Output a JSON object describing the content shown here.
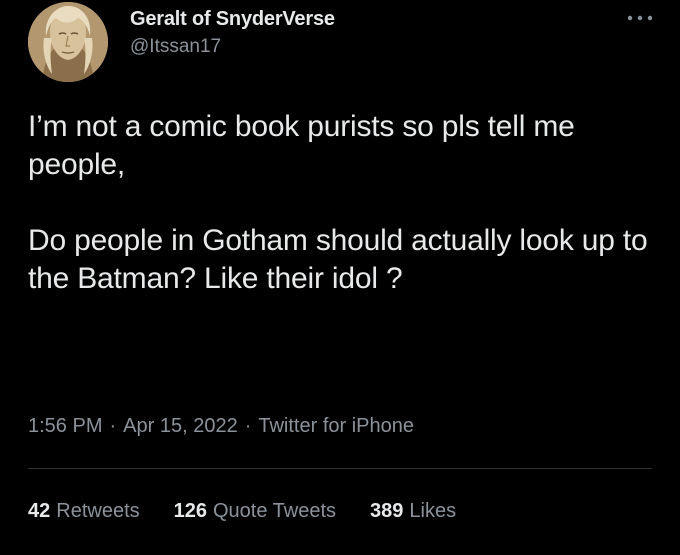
{
  "author": {
    "display_name": "Geralt of SnyderVerse",
    "handle": "@Itssan17",
    "avatar_icon": "user-avatar"
  },
  "tweet": {
    "text_paragraphs": [
      "I’m not a comic book purists so pls tell me people,",
      "Do people in Gotham should actually look up to the Batman? Like their idol ?"
    ]
  },
  "meta": {
    "time": "1:56 PM",
    "separator": "·",
    "date": "Apr 15, 2022",
    "source": "Twitter for iPhone"
  },
  "stats": {
    "retweets": {
      "count": "42",
      "label": "Retweets"
    },
    "quote_tweets": {
      "count": "126",
      "label": "Quote Tweets"
    },
    "likes": {
      "count": "389",
      "label": "Likes"
    }
  },
  "icons": {
    "more": "more-dots-icon"
  },
  "colors": {
    "background": "#000000",
    "text_primary": "#e7e9ea",
    "text_secondary": "#8b9299",
    "divider": "#2f3336"
  }
}
